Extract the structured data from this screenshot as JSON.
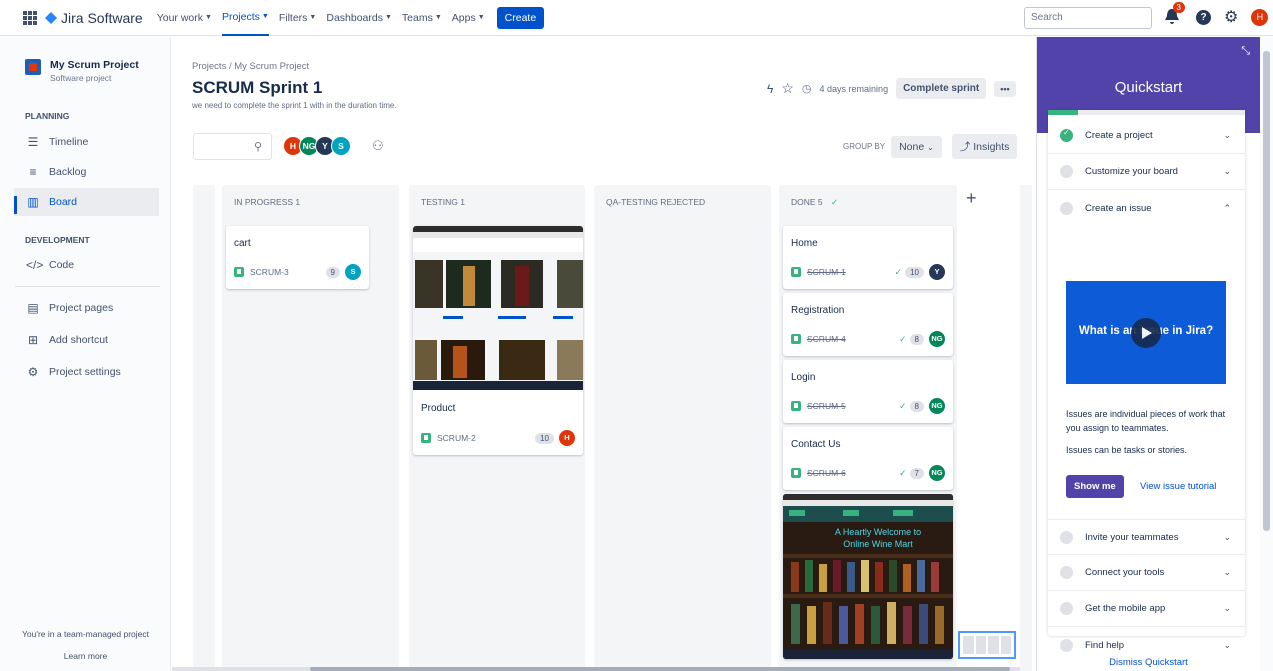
{
  "nav": {
    "product": "Jira Software",
    "items": [
      "Your work",
      "Projects",
      "Filters",
      "Dashboards",
      "Teams",
      "Apps"
    ],
    "active": "Projects",
    "create": "Create",
    "search_placeholder": "Search",
    "notifications": "3",
    "user_initial": "H"
  },
  "sidebar": {
    "project_name": "My Scrum Project",
    "project_type": "Software project",
    "planning_label": "PLANNING",
    "planning": [
      "Timeline",
      "Backlog",
      "Board"
    ],
    "development_label": "DEVELOPMENT",
    "development": [
      "Code"
    ],
    "other": [
      "Project pages",
      "Add shortcut",
      "Project settings"
    ],
    "footer": "You're in a team-managed project",
    "learn_more": "Learn more"
  },
  "board": {
    "breadcrumb": "Projects  /  My Scrum Project",
    "title": "SCRUM Sprint 1",
    "goal": "we need to complete the sprint 1 with in the duration time.",
    "remaining": "4 days remaining",
    "complete": "Complete sprint",
    "more": "•••",
    "group_by_label": "GROUP BY",
    "group_by_value": "None",
    "insights": "Insights",
    "assignees": [
      {
        "initials": "H",
        "color": "#de350b"
      },
      {
        "initials": "NG",
        "color": "#00875a"
      },
      {
        "initials": "Y",
        "color": "#253858"
      },
      {
        "initials": "S",
        "color": "#00a3bf"
      }
    ]
  },
  "columns": [
    {
      "title": "IN PROGRESS 1"
    },
    {
      "title": "TESTING 1"
    },
    {
      "title": "QA-TESTING REJECTED"
    },
    {
      "title": "DONE 5"
    }
  ],
  "cards": {
    "cart": {
      "title": "cart",
      "key": "SCRUM-3",
      "points": "9",
      "assignee": "S"
    },
    "product": {
      "title": "Product",
      "key": "SCRUM-2",
      "points": "10",
      "assignee": "H"
    },
    "home": {
      "title": "Home",
      "key": "SCRUM-1",
      "points": "10",
      "assignee": "Y"
    },
    "registration": {
      "title": "Registration",
      "key": "SCRUM-4",
      "points": "8",
      "assignee": "NG"
    },
    "login": {
      "title": "Login",
      "key": "SCRUM-5",
      "points": "8",
      "assignee": "NG"
    },
    "contact": {
      "title": "Contact Us",
      "key": "SCRUM-6",
      "points": "7",
      "assignee": "NG"
    },
    "welcome_text": "A Heartly Welcome to Online Wine Mart"
  },
  "quickstart": {
    "title": "Quickstart",
    "items": [
      "Create a project",
      "Customize your board",
      "Create an issue"
    ],
    "video_title": "What is an issue in Jira?",
    "text1": "Issues are individual pieces of work that you assign to teammates.",
    "text2": "Issues can be tasks or stories.",
    "show_me": "Show me",
    "view_tutorial": "View issue tutorial",
    "items2": [
      "Invite your teammates",
      "Connect your tools",
      "Get the mobile app",
      "Find help"
    ],
    "dismiss": "Dismiss Quickstart"
  }
}
